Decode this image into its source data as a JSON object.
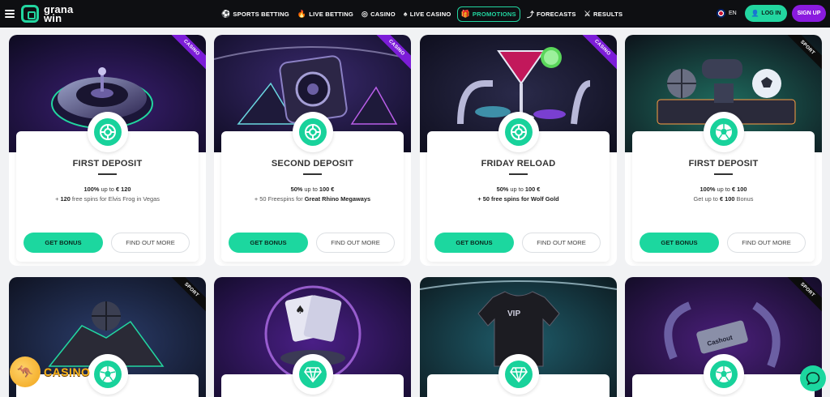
{
  "header": {
    "logo_line1": "grana",
    "logo_line2": "win",
    "nav": [
      {
        "label": "SPORTS BETTING",
        "icon": "soccer-ball-icon"
      },
      {
        "label": "LIVE BETTING",
        "icon": "flame-icon"
      },
      {
        "label": "CASINO",
        "icon": "roulette-icon"
      },
      {
        "label": "LIVE CASINO",
        "icon": "cards-icon"
      },
      {
        "label": "PROMOTIONS",
        "icon": "gift-icon",
        "active": true
      },
      {
        "label": "FORECASTS",
        "icon": "chart-icon"
      },
      {
        "label": "RESULTS",
        "icon": "crossed-swords-icon"
      }
    ],
    "language": "EN",
    "login_label": "LOG IN",
    "signup_label": "SIGN UP"
  },
  "cards": [
    {
      "tag": "CASINO",
      "title": "FIRST DEPOSIT",
      "line1_a": "100%",
      "line1_b": " up to ",
      "line1_c": "€ 120",
      "line2_a": "+ ",
      "line2_b": "120",
      "line2_c": " free spins for Elvis Frog in Vegas",
      "get_label": "GET BONUS",
      "more_label": "FIND OUT MORE",
      "icon": "roulette-icon"
    },
    {
      "tag": "CASINO",
      "title": "SECOND DEPOSIT",
      "line1_a": "50%",
      "line1_b": " up to ",
      "line1_c": "100 €",
      "line2_a": "+ 50 Freespins for ",
      "line2_b": "Great Rhino Megaways",
      "line2_c": "",
      "get_label": "GET BONUS",
      "more_label": "FIND OUT MORE",
      "icon": "roulette-icon"
    },
    {
      "tag": "CASINO",
      "title": "FRIDAY RELOAD",
      "line1_a": "50%",
      "line1_b": " up to ",
      "line1_c": "100 €",
      "line2_a": "+ 50 free spins for Wolf Gold",
      "line2_b": "",
      "line2_c": "",
      "get_label": "GET BONUS",
      "more_label": "FIND OUT MORE",
      "icon": "roulette-icon"
    },
    {
      "tag": "SPORT",
      "title": "FIRST DEPOSIT",
      "line1_a": "100%",
      "line1_b": " up to ",
      "line1_c": "€ 100",
      "line2_a": "Get up to ",
      "line2_b": "€ 100",
      "line2_c": " Bonus",
      "get_label": "GET BONUS",
      "more_label": "FIND OUT MORE",
      "icon": "soccer-ball-icon"
    }
  ],
  "row2": [
    {
      "tag": "SPORT",
      "icon": "soccer-ball-icon"
    },
    {
      "tag": "",
      "icon": "diamond-icon"
    },
    {
      "tag": "",
      "icon": "diamond-icon"
    },
    {
      "tag": "SPORT",
      "icon": "soccer-ball-icon"
    }
  ],
  "overlay": {
    "casino_watermark": "CASINO"
  },
  "colors": {
    "accent": "#1cd79f",
    "purple": "#8a1bdf",
    "header_bg": "#0e0f12"
  }
}
